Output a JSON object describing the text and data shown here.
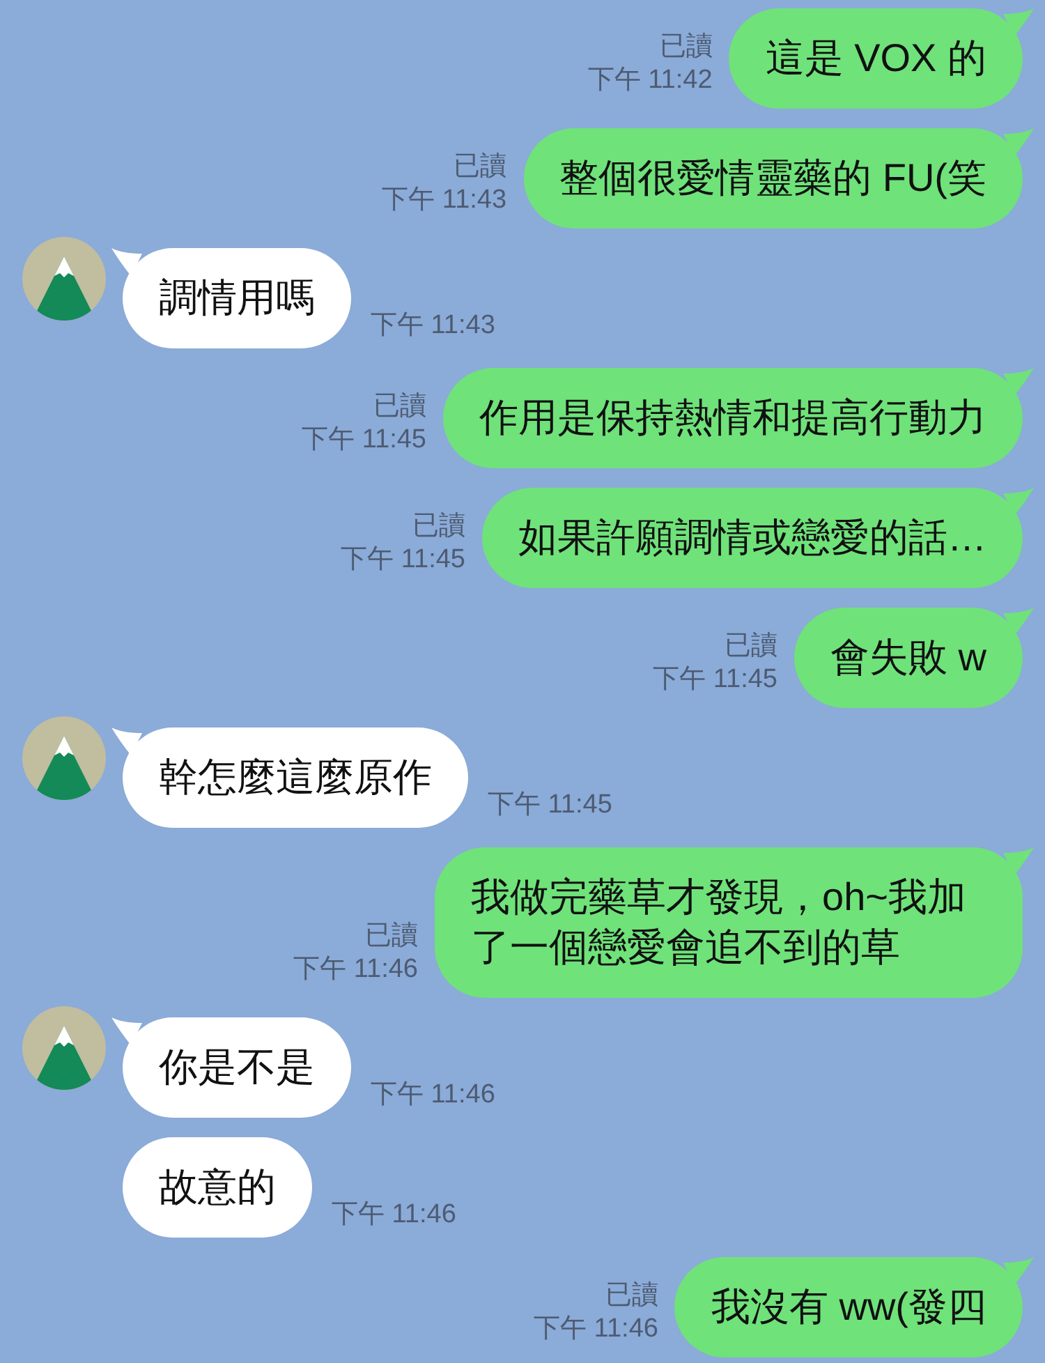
{
  "messages": [
    {
      "kind": "sent",
      "text": "這是 VOX 的",
      "read": "已讀",
      "time": "下午 11:42",
      "tail": true
    },
    {
      "kind": "sent",
      "text": "整個很愛情靈藥的 FU(笑",
      "read": "已讀",
      "time": "下午 11:43",
      "tail": true
    },
    {
      "kind": "received",
      "text": "調情用嗎",
      "time": "下午 11:43",
      "tail": true
    },
    {
      "kind": "sent",
      "text": "作用是保持熱情和提高行動力",
      "read": "已讀",
      "time": "下午 11:45",
      "tail": true
    },
    {
      "kind": "sent",
      "text": "如果許願調情或戀愛的話…",
      "read": "已讀",
      "time": "下午 11:45",
      "tail": true
    },
    {
      "kind": "sent",
      "text": "會失敗 w",
      "read": "已讀",
      "time": "下午 11:45",
      "tail": true
    },
    {
      "kind": "received",
      "text": "幹怎麼這麼原作",
      "time": "下午 11:45",
      "tail": true
    },
    {
      "kind": "sent",
      "text": "我做完藥草才發現，oh~我加了一個戀愛會追不到的草",
      "read": "已讀",
      "time": "下午 11:46",
      "tail": true
    },
    {
      "kind": "received",
      "text": "你是不是",
      "time": "下午 11:46",
      "tail": true
    },
    {
      "kind": "received",
      "text": "故意的",
      "time": "下午 11:46",
      "tail": false
    },
    {
      "kind": "sent",
      "text": "我沒有 ww(發四",
      "read": "已讀",
      "time": "下午 11:46",
      "tail": true
    }
  ]
}
